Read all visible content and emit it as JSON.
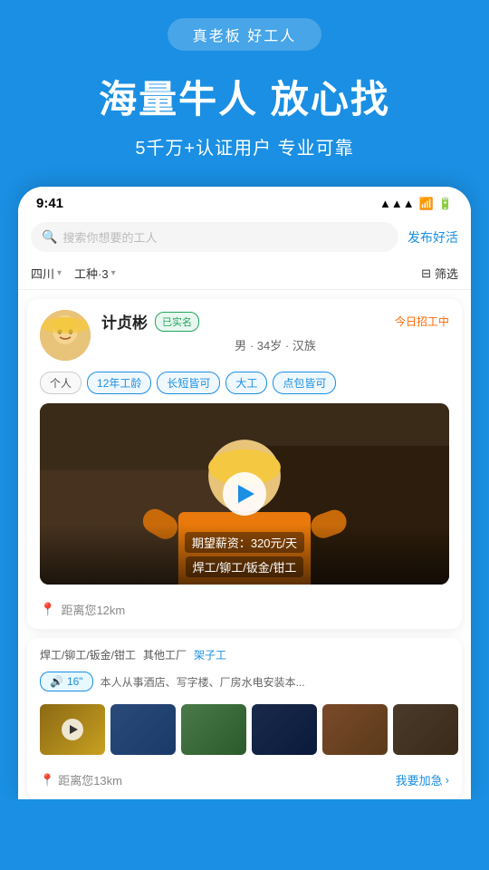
{
  "app": {
    "tagline": "真老板  好工人",
    "hero_title": "海量牛人 放心找",
    "hero_subtitle": "5千万+认证用户 专业可靠"
  },
  "phone": {
    "status_time": "9:41",
    "signal_icon": "▲▲▲",
    "wifi_icon": "WiFi",
    "battery_icon": "🔋"
  },
  "search": {
    "placeholder": "搜索你想要的工人",
    "post_job_label": "发布好活"
  },
  "filters": {
    "province": "四川",
    "job_type": "工种·3",
    "filter_label": "筛选"
  },
  "worker_card": {
    "name": "计贞彬",
    "verified_label": "已实名",
    "hiring_status": "今日招工中",
    "gender": "男",
    "age": "34岁",
    "ethnicity": "汉族",
    "tags": [
      "个人",
      "12年工龄",
      "长短皆可",
      "大工",
      "点包皆可"
    ],
    "salary_label": "期望薪资：320元/天",
    "skills": "焊工/铆工/钣金/钳工",
    "distance": "距离您12km"
  },
  "second_card": {
    "skill_tags": [
      "焊工/铆工/钣金/钳工",
      "其他工厂",
      "架子工"
    ],
    "voice_duration": "16\"",
    "voice_desc": "本人从事酒店、写字楼、厂房水电安装本...",
    "distance": "距离您13km",
    "urgent_label": "我要加急",
    "thumbnail_count": 6
  },
  "icons": {
    "search": "🔍",
    "location": "📍",
    "play": "▶",
    "filter": "⊟",
    "chevron_down": "▾",
    "sound": "🔊",
    "chevron_right": "›"
  }
}
